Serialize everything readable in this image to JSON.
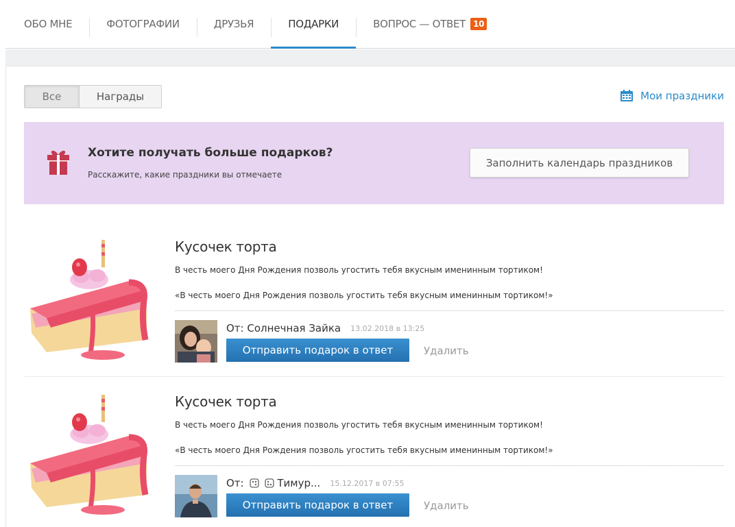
{
  "tabs": [
    {
      "label": "ОБО МНЕ"
    },
    {
      "label": "ФОТОГРАФИИ"
    },
    {
      "label": "ДРУЗЬЯ"
    },
    {
      "label": "ПОДАРКИ",
      "active": true
    },
    {
      "label": "ВОПРОС — ОТВЕТ",
      "badge": "10"
    }
  ],
  "filter": {
    "all": "Все",
    "awards": "Награды"
  },
  "my_holidays": "Мои праздники",
  "promo": {
    "title": "Хотите получать больше подарков?",
    "subtitle": "Расскажите, какие праздники вы отмечаете",
    "button": "Заполнить календарь праздников"
  },
  "gifts": [
    {
      "title": "Кусочек торта",
      "description": "В честь моего Дня Рождения позволь угостить тебя вкусным именинным тортиком!",
      "quote": "«В честь моего Дня Рождения позволь угостить тебя вкусным именинным тортиком!»",
      "from_prefix": "От:",
      "from_name": "Солнечная Зайка",
      "date": "13.02.2018 в 13:25",
      "send_button": "Отправить подарок в ответ",
      "delete": "Удалить"
    },
    {
      "title": "Кусочек торта",
      "description": "В честь моего Дня Рождения позволь угостить тебя вкусным именинным тортиком!",
      "quote": "«В честь моего Дня Рождения позволь угостить тебя вкусным именинным тортиком!»",
      "from_prefix": "От:",
      "from_name": "Тимур...",
      "date": "15.12.2017 в 07:55",
      "send_button": "Отправить подарок в ответ",
      "delete": "Удалить"
    }
  ],
  "colors": {
    "accent": "#2a8bc9",
    "badge": "#ec5f14",
    "promo_bg": "#e7d5f1",
    "button": "#2a7fc1"
  },
  "icons": {
    "calendar": "calendar-icon",
    "gift": "gift-icon",
    "dice": "dice-icon"
  }
}
